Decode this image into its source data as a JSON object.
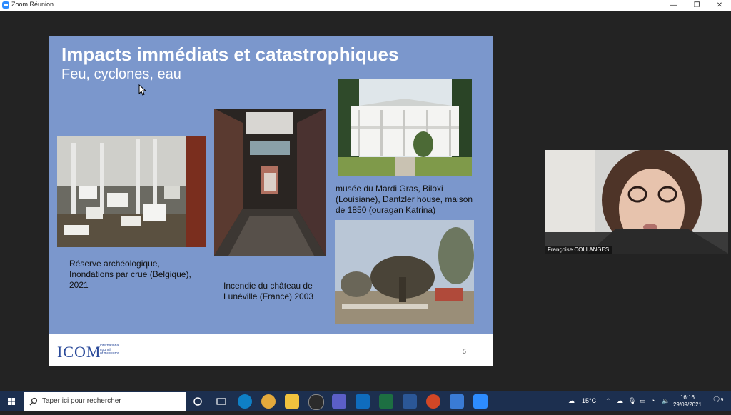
{
  "window": {
    "title": "Zoom Réunion",
    "min": "—",
    "max": "❐",
    "close": "✕"
  },
  "slide": {
    "title": "Impacts immédiats et catastrophiques",
    "subtitle": "Feu, cyclones, eau",
    "captions": {
      "archeo": [
        "Réserve archéologique,",
        "Inondations par crue (Belgique),",
        "2021"
      ],
      "luneville": [
        "Incendie du château de",
        "Lunéville (France) 2003"
      ],
      "biloxi": [
        "musée du Mardi Gras, Biloxi",
        "(Louisiane), Dantzler house, maison",
        "de 1850 (ouragan Katrina)"
      ]
    },
    "logo": "ICOM",
    "logo_sub": [
      "international",
      "council",
      "of museums"
    ],
    "page_number": "5"
  },
  "participant": {
    "name": "Françoise COLLANGES"
  },
  "taskbar": {
    "search_placeholder": "Taper ici pour rechercher",
    "weather": "15°C",
    "time": "16:16",
    "date": "29/09/2021",
    "notifications": "9"
  },
  "colors": {
    "slide_bg": "#7b97cc",
    "taskbar": "#1c2f4f",
    "zoom_blue": "#2d8cff"
  }
}
